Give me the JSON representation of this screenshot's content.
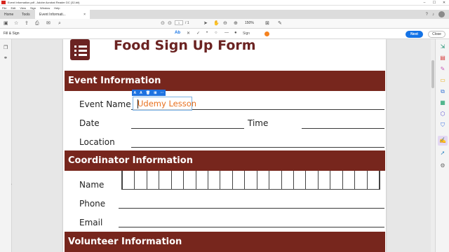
{
  "window": {
    "title": "Event Information.pdf - Adobe Acrobat Reader DC (32-bit)",
    "controls": [
      "–",
      "☐",
      "✕"
    ]
  },
  "menu": [
    "File",
    "Edit",
    "View",
    "Sign",
    "Window",
    "Help"
  ],
  "tabs": {
    "home": "Home",
    "tools": "Tools",
    "document": "Event Informati...",
    "document_close": "×"
  },
  "toolbar": {
    "page_current": "1",
    "page_total": "/ 1",
    "zoom": "150%"
  },
  "fill_sign": {
    "label": "Fill & Sign",
    "tool_text": "Ab",
    "tool_cross": "✕",
    "tool_check": "✓",
    "tool_dot": "•",
    "tool_circle": "○",
    "tool_line": "—",
    "tool_bullet": "●",
    "sign_label": "Sign",
    "color_hex": "#f5821f",
    "next_button": "Next",
    "close_button": "Close"
  },
  "form": {
    "title": "Food Sign Up Form",
    "sections": {
      "event": "Event Information",
      "coordinator": "Coordinator Information",
      "volunteer": "Volunteer Information"
    },
    "labels": {
      "event_name": "Event Name",
      "date": "Date",
      "time": "Time",
      "location": "Location",
      "name": "Name",
      "phone": "Phone",
      "email": "Email"
    },
    "event_name_value": "Udemy Lesson",
    "name_comb_cells": 21
  },
  "minibar": {
    "shrink": "A",
    "grow": "A",
    "delete": "🗑",
    "comb": "⊞",
    "more": "···"
  }
}
